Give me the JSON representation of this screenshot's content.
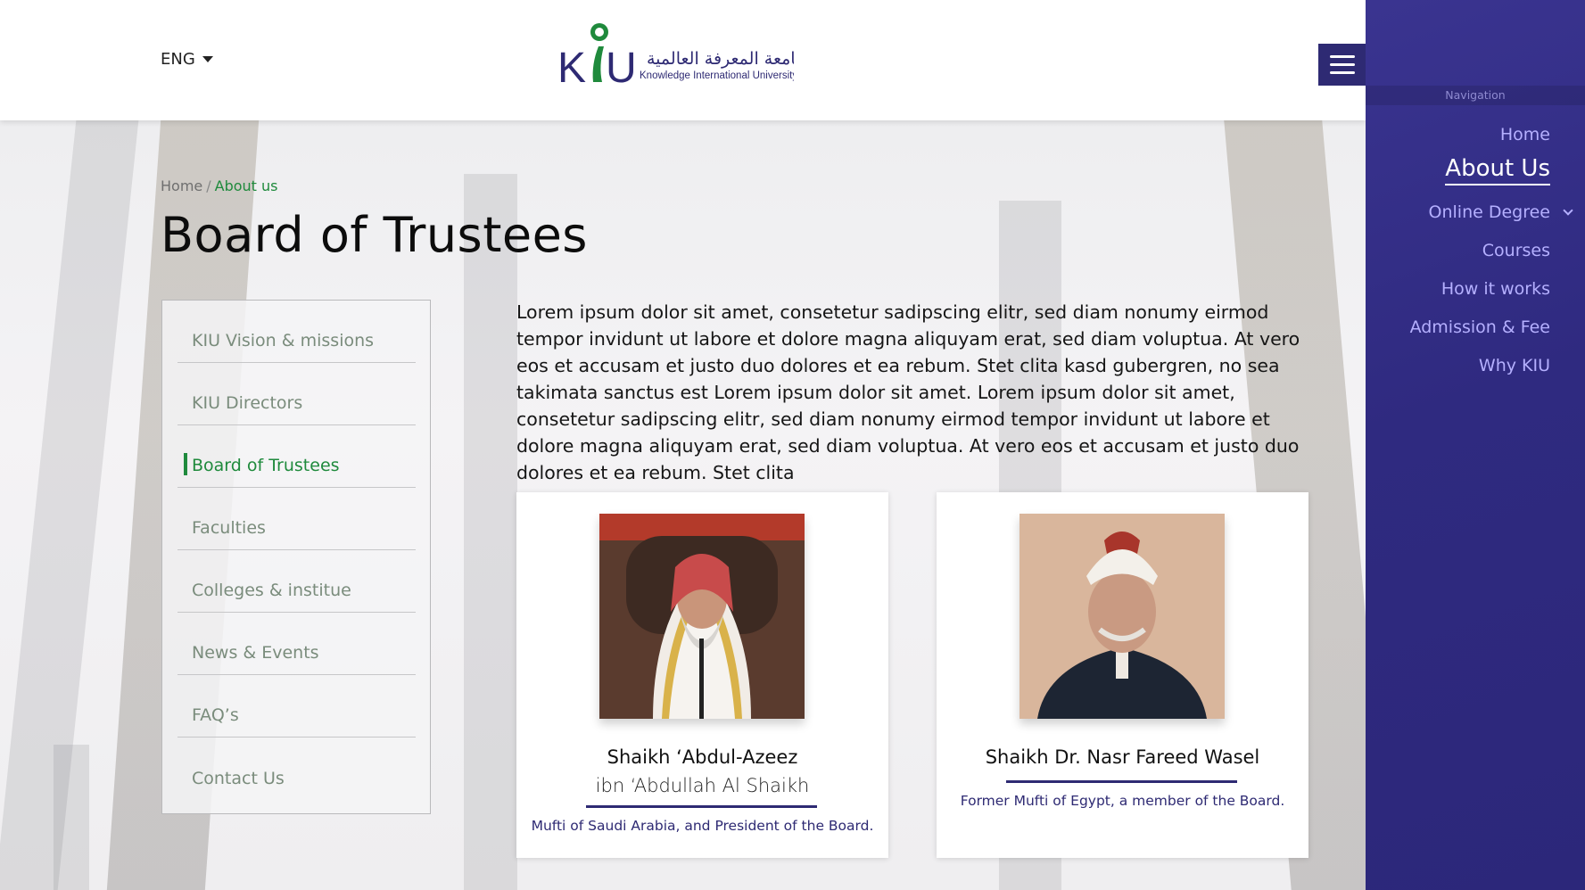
{
  "header": {
    "language": "ENG",
    "logo_en": "Knowledge International University",
    "logo_ar": "جامعة المعرفة العالمية",
    "logo_mark": "KIU"
  },
  "breadcrumb": {
    "home": "Home",
    "separator": "/",
    "current": "About us"
  },
  "page_title": "Board of Trustees",
  "sidemenu": {
    "items": [
      {
        "label": "KIU Vision & missions"
      },
      {
        "label": "KIU Directors"
      },
      {
        "label": "Board of Trustees",
        "active": true
      },
      {
        "label": "Faculties"
      },
      {
        "label": "Colleges & institue"
      },
      {
        "label": "News & Events"
      },
      {
        "label": "FAQ’s"
      },
      {
        "label": "Contact Us"
      }
    ]
  },
  "intro": "Lorem ipsum dolor sit amet, consetetur sadipscing elitr, sed diam nonumy eirmod tempor invidunt ut labore et dolore magna aliquyam erat, sed diam voluptua. At vero eos et accusam et justo duo dolores et ea rebum. Stet clita kasd gubergren, no sea takimata sanctus est Lorem ipsum dolor sit amet. Lorem ipsum dolor sit amet, consetetur sadipscing elitr, sed diam nonumy eirmod tempor invidunt ut labore et dolore magna aliquyam erat, sed diam voluptua. At vero eos et accusam et justo duo dolores et ea rebum. Stet clita",
  "trustees": [
    {
      "name_line1": "Shaikh ‘Abdul-Azeez",
      "name_line2": "ibn ‘Abdullah Al Shaikh",
      "role": "Mufti of Saudi Arabia, and President of the Board."
    },
    {
      "name_line1": "Shaikh Dr. Nasr Fareed Wasel",
      "role": "Former Mufti of Egypt, a member of the Board."
    }
  ],
  "nav": {
    "label": "Navigation",
    "links": [
      {
        "label": "Home"
      },
      {
        "label": "About Us",
        "active": true
      },
      {
        "label": "Online Degree",
        "has_dropdown": true
      },
      {
        "label": "Courses"
      },
      {
        "label": "How it works"
      },
      {
        "label": "Admission & Fee"
      },
      {
        "label": "Why KIU"
      }
    ]
  },
  "colors": {
    "accent_green": "#1f8a3c",
    "brand_navy": "#2e2a73",
    "nav_link": "#b5b0ff"
  }
}
